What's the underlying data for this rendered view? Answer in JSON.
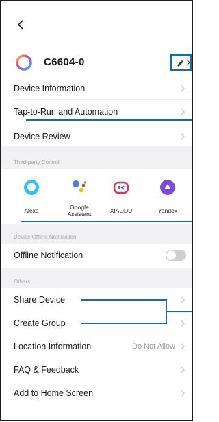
{
  "header": {
    "device_name": "C6604-0"
  },
  "rows": {
    "device_information": "Device Information",
    "tap_to_run": "Tap-to-Run and Automation",
    "device_review": "Device Review"
  },
  "third_party": {
    "section_label": "Third-party Control",
    "items": [
      {
        "label": "Alexa",
        "icon": "alexa-icon"
      },
      {
        "label": "Google\nAssistant",
        "icon": "google-assistant-icon"
      },
      {
        "label": "XIAODU",
        "icon": "xiaodu-icon"
      },
      {
        "label": "Yandex",
        "icon": "yandex-icon"
      }
    ]
  },
  "offline": {
    "section_label": "Device Offline Notification",
    "label": "Offline Notification",
    "enabled": false
  },
  "others": {
    "section_label": "Others",
    "share_device": "Share Device",
    "create_group": "Create Group",
    "location_information": "Location Information",
    "location_value": "Do Not Allow",
    "faq_feedback": "FAQ & Feedback",
    "add_to_home": "Add to Home Screen"
  },
  "colors": {
    "annotation": "#1769b2",
    "chevron": "#c4c4c4"
  }
}
